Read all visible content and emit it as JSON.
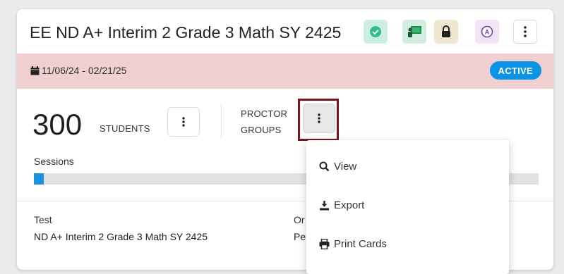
{
  "card": {
    "title": "EE ND A+ Interim 2 Grade 3 Math SY 2425",
    "header_icons": [
      "check-badge-icon",
      "presenter-board-icon",
      "lock-icon",
      "accommodation-a-icon",
      "kebab-menu-icon"
    ],
    "date_range": "11/06/24 - 02/21/25",
    "status": "ACTIVE",
    "student_count": "300",
    "students_label": "STUDENTS",
    "proctor_label_line1": "PROCTOR",
    "proctor_label_line2": "GROUPS",
    "sessions_label": "Sessions",
    "sessions_progress": 0.02,
    "test_label": "Test",
    "test_value": "ND A+ Interim 2 Grade 3 Math SY 2425",
    "col2_label_partial": "Or",
    "col2_value_partial": "Pe"
  },
  "menu": {
    "items": [
      {
        "label": "View",
        "icon": "search-icon"
      },
      {
        "label": "Export",
        "icon": "download-icon"
      },
      {
        "label": "Print Cards",
        "icon": "printer-icon"
      }
    ]
  },
  "colors": {
    "date_band": "#efcfcf",
    "active_badge": "#0b94e6",
    "progress_fill": "#1e90e0",
    "highlight_border": "#7b1420"
  }
}
